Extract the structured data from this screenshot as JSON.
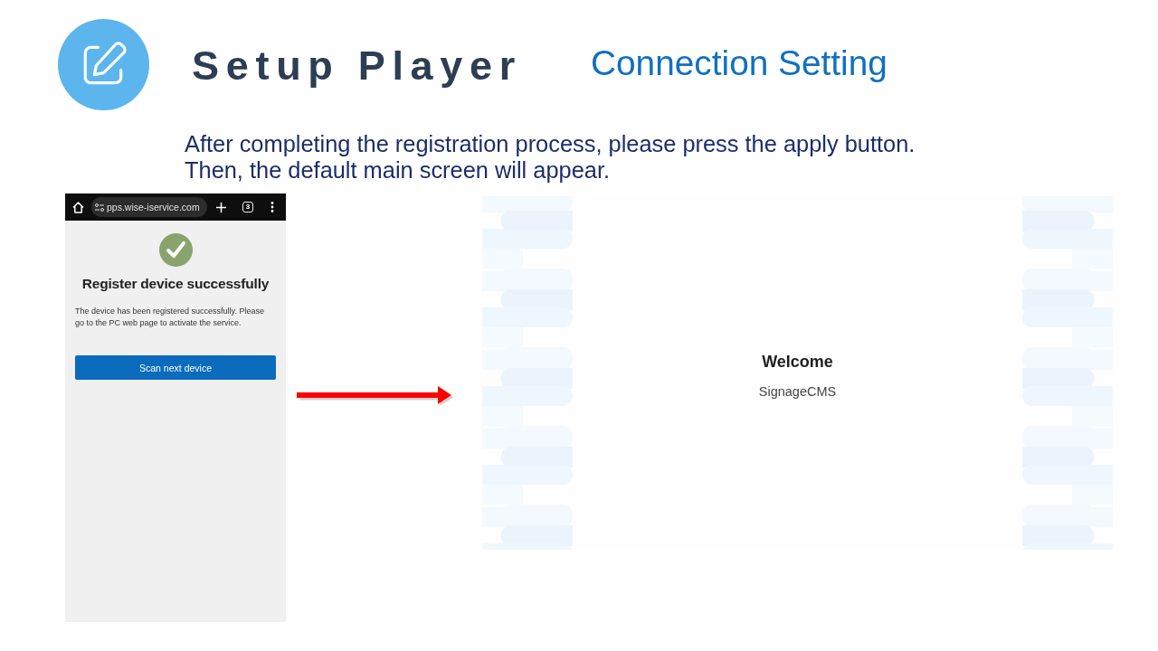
{
  "header": {
    "title": "Setup Player",
    "subtitle": "Connection Setting"
  },
  "instructions": [
    "After completing the registration process, please press the apply button.",
    "Then, the default main screen will appear."
  ],
  "phone_screenshot": {
    "browser_bar": {
      "url": "pps.wise-iservice.com",
      "tab_count": "3"
    },
    "heading": "Register device successfully",
    "message": "The device has been registered successfully. Please go to the PC web page to activate the service.",
    "button": "Scan next device"
  },
  "player_screen": {
    "heading": "Welcome",
    "app_name": "SignageCMS"
  }
}
